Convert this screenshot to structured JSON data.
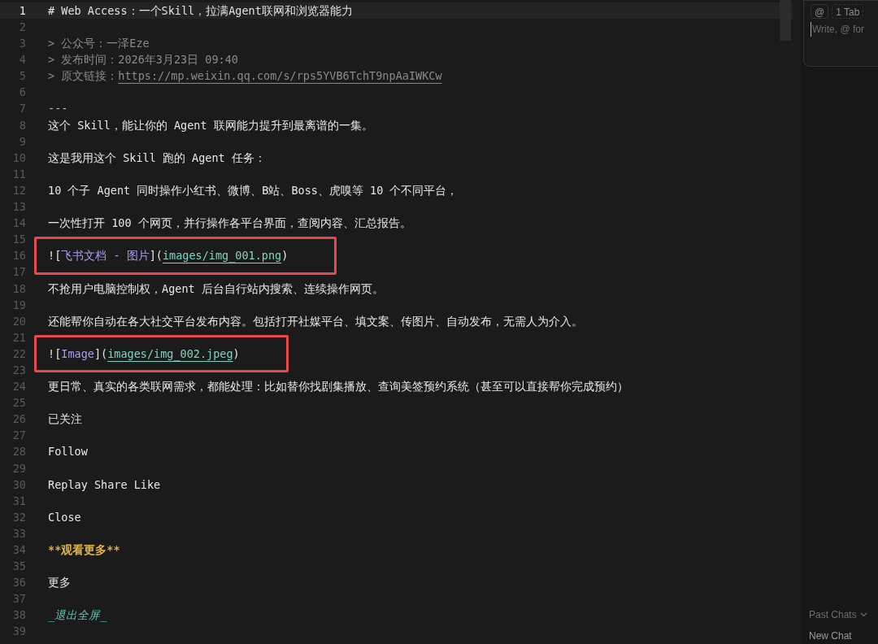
{
  "editor": {
    "lines": [
      {
        "number": "1",
        "current": true,
        "boxed": false,
        "segments": [
          {
            "kind": "heading",
            "text": "# Web Access：一个Skill，拉满Agent联网和浏览器能力"
          }
        ]
      },
      {
        "number": "2",
        "current": false,
        "boxed": false
      },
      {
        "number": "3",
        "current": false,
        "boxed": false,
        "segments": [
          {
            "kind": "quote",
            "text": "> 公众号：一泽Eze"
          }
        ]
      },
      {
        "number": "4",
        "current": false,
        "boxed": false,
        "segments": [
          {
            "kind": "quote",
            "text": "> 发布时间：2026年3月23日 09:40"
          }
        ]
      },
      {
        "number": "5",
        "current": false,
        "boxed": false,
        "segments": [
          {
            "kind": "quote",
            "text": "> 原文链接："
          },
          {
            "kind": "quote-link",
            "text": "https://mp.weixin.qq.com/s/rps5YVB6TchT9npAaIWKCw"
          }
        ]
      },
      {
        "number": "6",
        "current": false,
        "boxed": false
      },
      {
        "number": "7",
        "current": false,
        "boxed": false,
        "segments": [
          {
            "kind": "rule",
            "text": "---"
          }
        ]
      },
      {
        "number": "8",
        "current": false,
        "boxed": false,
        "segments": [
          {
            "kind": "text",
            "text": "这个 Skill，能让你的 Agent 联网能力提升到最离谱的一集。"
          }
        ]
      },
      {
        "number": "9",
        "current": false,
        "boxed": false
      },
      {
        "number": "10",
        "current": false,
        "boxed": false,
        "segments": [
          {
            "kind": "text",
            "text": "这是我用这个 Skill 跑的 Agent 任务："
          }
        ]
      },
      {
        "number": "11",
        "current": false,
        "boxed": false
      },
      {
        "number": "12",
        "current": false,
        "boxed": false,
        "segments": [
          {
            "kind": "text",
            "text": "10 个子 Agent 同时操作小红书、微博、B站、Boss、虎嗅等 10 个不同平台，"
          }
        ]
      },
      {
        "number": "13",
        "current": false,
        "boxed": false
      },
      {
        "number": "14",
        "current": false,
        "boxed": false,
        "segments": [
          {
            "kind": "text",
            "text": "一次性打开 100 个网页，并行操作各平台界面，查阅内容、汇总报告。"
          }
        ]
      },
      {
        "number": "15",
        "current": false,
        "boxed": false
      },
      {
        "number": "16",
        "current": false,
        "boxed": true,
        "segments": [
          {
            "kind": "text",
            "text": "!["
          },
          {
            "kind": "alt",
            "text": "飞书文档 - 图片"
          },
          {
            "kind": "text",
            "text": "]("
          },
          {
            "kind": "url",
            "text": "images/img_001.png"
          },
          {
            "kind": "text",
            "text": ")"
          }
        ]
      },
      {
        "number": "17",
        "current": false,
        "boxed": false
      },
      {
        "number": "18",
        "current": false,
        "boxed": false,
        "segments": [
          {
            "kind": "text",
            "text": "不抢用户电脑控制权，Agent 后台自行站内搜索、连续操作网页。"
          }
        ]
      },
      {
        "number": "19",
        "current": false,
        "boxed": false
      },
      {
        "number": "20",
        "current": false,
        "boxed": false,
        "segments": [
          {
            "kind": "text",
            "text": "还能帮你自动在各大社交平台发布内容。包括打开社媒平台、填文案、传图片、自动发布，无需人为介入。"
          }
        ]
      },
      {
        "number": "21",
        "current": false,
        "boxed": false
      },
      {
        "number": "22",
        "current": false,
        "boxed": true,
        "segments": [
          {
            "kind": "text",
            "text": "!["
          },
          {
            "kind": "alt",
            "text": "Image"
          },
          {
            "kind": "text",
            "text": "]("
          },
          {
            "kind": "url",
            "text": "images/img_002.jpeg"
          },
          {
            "kind": "text",
            "text": ")"
          }
        ]
      },
      {
        "number": "23",
        "current": false,
        "boxed": false
      },
      {
        "number": "24",
        "current": false,
        "boxed": false,
        "segments": [
          {
            "kind": "text",
            "text": "更日常、真实的各类联网需求，都能处理：比如替你找剧集播放、查询美签预约系统（甚至可以直接帮你完成预约）"
          }
        ]
      },
      {
        "number": "25",
        "current": false,
        "boxed": false
      },
      {
        "number": "26",
        "current": false,
        "boxed": false,
        "segments": [
          {
            "kind": "text",
            "text": "已关注"
          }
        ]
      },
      {
        "number": "27",
        "current": false,
        "boxed": false
      },
      {
        "number": "28",
        "current": false,
        "boxed": false,
        "segments": [
          {
            "kind": "text",
            "text": "Follow"
          }
        ]
      },
      {
        "number": "29",
        "current": false,
        "boxed": false
      },
      {
        "number": "30",
        "current": false,
        "boxed": false,
        "segments": [
          {
            "kind": "text",
            "text": "Replay Share Like"
          }
        ]
      },
      {
        "number": "31",
        "current": false,
        "boxed": false
      },
      {
        "number": "32",
        "current": false,
        "boxed": false,
        "segments": [
          {
            "kind": "text",
            "text": "Close"
          }
        ]
      },
      {
        "number": "33",
        "current": false,
        "boxed": false
      },
      {
        "number": "34",
        "current": false,
        "boxed": false,
        "segments": [
          {
            "kind": "bold",
            "text": "**观看更多**"
          }
        ]
      },
      {
        "number": "35",
        "current": false,
        "boxed": false
      },
      {
        "number": "36",
        "current": false,
        "boxed": false,
        "segments": [
          {
            "kind": "text",
            "text": "更多"
          }
        ]
      },
      {
        "number": "37",
        "current": false,
        "boxed": false
      },
      {
        "number": "38",
        "current": false,
        "boxed": false,
        "segments": [
          {
            "kind": "italic",
            "text": "_退出全屏_"
          }
        ]
      },
      {
        "number": "39",
        "current": false,
        "boxed": false
      }
    ]
  },
  "chat_panel": {
    "chips": [
      {
        "kind": "mention",
        "text": "@"
      },
      {
        "kind": "tab",
        "text": "1 Tab"
      }
    ],
    "input": {
      "placeholder": "Write, @ for"
    },
    "past_chats": "Past Chats",
    "new_chat": "New Chat"
  }
}
